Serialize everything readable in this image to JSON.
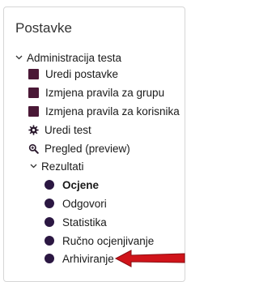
{
  "block": {
    "title": "Postavke",
    "section": {
      "label": "Administracija testa",
      "icon": "chevron-down-icon"
    },
    "items": [
      {
        "label": "Uredi postavke",
        "icon": "square-icon"
      },
      {
        "label": "Izmjena pravila za grupu",
        "icon": "square-icon"
      },
      {
        "label": "Izmjena pravila za korisnika",
        "icon": "square-icon"
      },
      {
        "label": "Uredi test",
        "icon": "gear-icon"
      },
      {
        "label": "Pregled (preview)",
        "icon": "magnifier-icon"
      }
    ],
    "subsection": {
      "label": "Rezultati",
      "icon": "chevron-down-icon"
    },
    "results": [
      {
        "label": "Ocjene",
        "active": true
      },
      {
        "label": "Odgovori"
      },
      {
        "label": "Statistika"
      },
      {
        "label": "Ručno ocjenjivanje"
      },
      {
        "label": "Arhiviranje"
      }
    ]
  },
  "colors": {
    "square": "#4a1836",
    "dot": "#2b1742",
    "arrow": "#d0141a"
  }
}
